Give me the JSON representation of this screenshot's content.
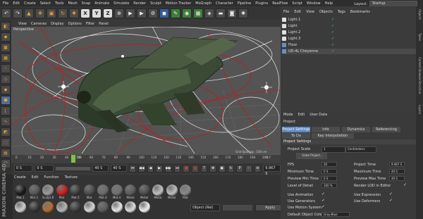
{
  "menubar": {
    "items": [
      "File",
      "Edit",
      "Create",
      "Select",
      "Tools",
      "Mesh",
      "Snap",
      "Animate",
      "Simulate",
      "Render",
      "Sculpt",
      "Motion Tracker",
      "MoGraph",
      "Character",
      "Pipeline",
      "Plugins",
      "RealFlow",
      "Script",
      "Window",
      "Help"
    ],
    "layout_label": "Layout:",
    "layout_value": "Startup"
  },
  "toolbar": {
    "axis_letters": [
      "X",
      "Y",
      "Z"
    ]
  },
  "viewport": {
    "menu": [
      "View",
      "Cameras",
      "Display",
      "Options",
      "Filter",
      "Panel"
    ],
    "label": "Perspective",
    "grid_text": "Grid Spacing : 100 cm"
  },
  "timeline": {
    "ticks": [
      "0",
      "10",
      "20",
      "30",
      "40",
      "50",
      "60",
      "70",
      "80",
      "90",
      "100",
      "110",
      "120",
      "130",
      "140",
      "150",
      "160",
      "170",
      "180",
      "190",
      "200"
    ],
    "current_frame": "299",
    "end_label": "0 F"
  },
  "playbar": {
    "start": "0 S",
    "current": "0 S",
    "end": "40 S",
    "end2": "40 S",
    "time": "9.967 S"
  },
  "materials": {
    "menu": [
      "Create",
      "Edit",
      "Function",
      "Texture"
    ],
    "brand": "MAXON CINEMA 4D",
    "row1": [
      {
        "label": "Mat.1",
        "color": "#1a1a1a"
      },
      {
        "label": "Mat.1",
        "color": "#555555"
      },
      {
        "label": "Sculpt B",
        "color": "#9a9a9a"
      },
      {
        "label": "Mat",
        "color": "#d11a1a"
      },
      {
        "label": "Mat.5",
        "color": "#3a3a3a"
      },
      {
        "label": "Mat",
        "color": "#4a4a4a"
      },
      {
        "label": "Mat.4",
        "color": "#6a6a6a"
      },
      {
        "label": "Mat.4",
        "color": "#707070"
      },
      {
        "label": "Metal",
        "color": "#5a5a5a"
      },
      {
        "label": "Metal",
        "color": "#4a4a4a"
      },
      {
        "label": "Metal",
        "color": "#c0c0c0"
      },
      {
        "label": "Metal",
        "color": "#bdbdbd"
      },
      {
        "label": "Mat",
        "color": "#888888"
      }
    ],
    "row2": [
      {
        "label": "",
        "color": "#cfcfcf"
      },
      {
        "label": "",
        "color": "#333333"
      },
      {
        "label": "",
        "color": "#b86a2a"
      },
      {
        "label": "",
        "color": "#b5b5b5"
      },
      {
        "label": "",
        "color": "#3b3b3b"
      },
      {
        "label": "",
        "color": "#d8d8d8"
      },
      {
        "label": "",
        "color": "#5a5a5a"
      },
      {
        "label": "",
        "color": "#e6e6e6"
      },
      {
        "label": "",
        "color": "#dcdcdc"
      },
      {
        "label": "",
        "color": "#f0f0f0"
      }
    ],
    "mode_value": "Object (Rel)",
    "apply_label": "Apply"
  },
  "objects": {
    "menu": [
      "File",
      "Edit",
      "View",
      "Objects",
      "Tags",
      "Bookmarks"
    ],
    "items": [
      {
        "name": "Light.1",
        "icon_color": "#e0e0e0"
      },
      {
        "name": "Light",
        "icon_color": "#e0e0e0"
      },
      {
        "name": "Light.2",
        "icon_color": "#e0e0e0"
      },
      {
        "name": "Light.3",
        "icon_color": "#e0e0e0"
      },
      {
        "name": "Floor",
        "icon_color": "#6a8fc4"
      },
      {
        "name": "UD-4L Cheyenne",
        "icon_color": "#6a8fc4"
      }
    ]
  },
  "side_tabs": [
    "Objects",
    "Takes",
    "Content Browser",
    "Structure",
    "Layers"
  ],
  "attributes": {
    "menu": [
      "Mode",
      "Edit",
      "User Data"
    ],
    "title": "Project",
    "tabs_row1": [
      "Project Settings",
      "Info",
      "Dynamics",
      "Referencing"
    ],
    "tabs_row2": [
      "To Do",
      "Key Interpolation"
    ],
    "section": "Project Settings",
    "project_scale_label": "Project Scale",
    "project_scale_value": "1",
    "project_scale_unit": "Centimeters",
    "scale_button": "Scale Project...",
    "fields_left": [
      {
        "label": "FPS",
        "value": "30"
      },
      {
        "label": "Minimum Time",
        "value": "0 S"
      },
      {
        "label": "Preview Min Time",
        "value": "0 S"
      },
      {
        "label": "Level of Detail",
        "value": "100 %"
      }
    ],
    "fields_right": [
      {
        "label": "Project Time",
        "value": "9.967 S"
      },
      {
        "label": "Maximum Time",
        "value": "40 S"
      },
      {
        "label": "Preview Max Time",
        "value": "40 S"
      },
      {
        "label": "Render LOD in Editor",
        "value": ""
      }
    ],
    "checks_left": [
      "Use Animation",
      "Use Generators",
      "Use Motion System"
    ],
    "checks_right": [
      "Use Expression",
      "Use Deformers"
    ],
    "default_color_label": "Default Object Color",
    "default_color_value": "Gray-Blue"
  }
}
